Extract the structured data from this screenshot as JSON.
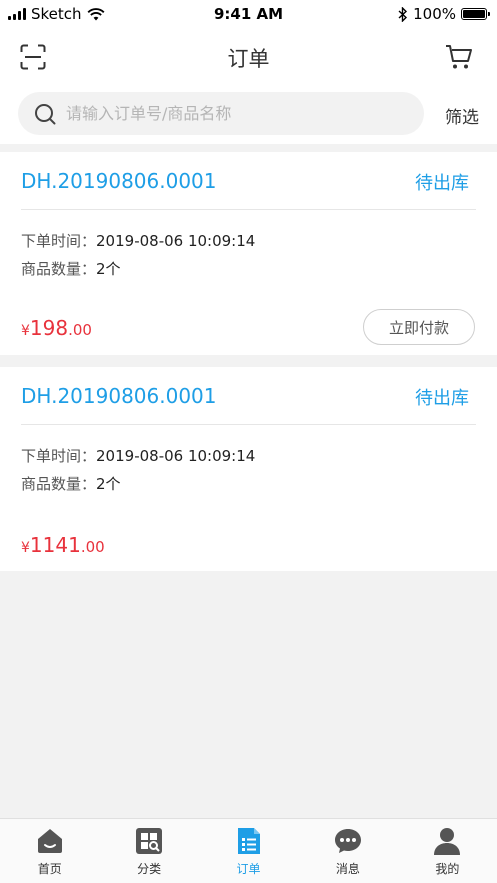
{
  "status_bar": {
    "carrier": "Sketch",
    "time": "9:41 AM",
    "battery": "100%"
  },
  "nav": {
    "title": "订单",
    "left_icon": "scan-icon",
    "right_icon": "cart-icon"
  },
  "search": {
    "placeholder": "请输入订单号/商品名称",
    "value": "",
    "filter_label": "筛选"
  },
  "orders": [
    {
      "order_no": "DH.20190806.0001",
      "status": "待出库",
      "time_label": "下单时间：",
      "time_value": "2019-08-06 10:09:14",
      "qty_label": "商品数量：",
      "qty_value": "2个",
      "currency": "¥",
      "price_int": "198",
      "price_dec": ".00",
      "action_label": "立即付款"
    },
    {
      "order_no": "DH.20190806.0001",
      "status": "待出库",
      "time_label": "下单时间：",
      "time_value": "2019-08-06 10:09:14",
      "qty_label": "商品数量：",
      "qty_value": "2个",
      "currency": "¥",
      "price_int": "1141",
      "price_dec": ".00"
    }
  ],
  "tabs": [
    {
      "label": "首页",
      "icon": "home-icon",
      "active": false
    },
    {
      "label": "分类",
      "icon": "category-icon",
      "active": false
    },
    {
      "label": "订单",
      "icon": "order-list-icon",
      "active": true
    },
    {
      "label": "消息",
      "icon": "message-icon",
      "active": false
    },
    {
      "label": "我的",
      "icon": "profile-icon",
      "active": false
    }
  ],
  "colors": {
    "accent": "#1e9ee6",
    "price": "#e8323c",
    "tab_inactive_icon": "#555555"
  }
}
